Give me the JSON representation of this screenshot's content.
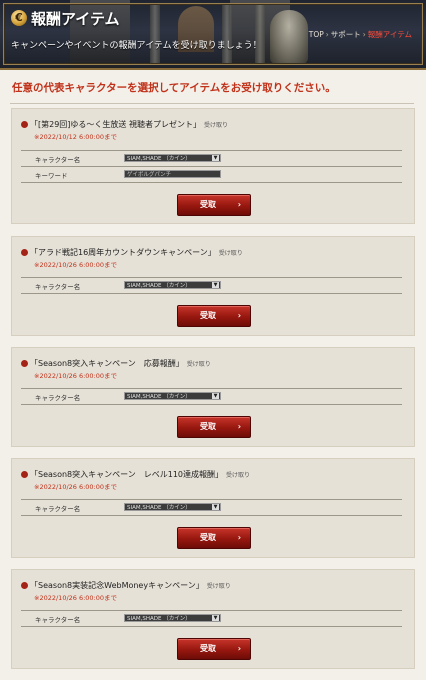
{
  "header": {
    "title": "報酬アイテム",
    "subtitle": "キャンペーンやイベントの報酬アイテムを受け取りましょう！",
    "breadcrumb": [
      "TOP",
      "サポート",
      "報酬アイテム"
    ]
  },
  "instruction": "任意の代表キャラクターを選択してアイテムをお受け取りください。",
  "campaigns": [
    {
      "title": "「[第29回]ゆる～く生放送 視聴者プレゼント」",
      "suffix": "受け取り",
      "deadline": "※2022/10/12 6:00:00まで",
      "character_label": "キャラクター名",
      "character_value": "SIAM,SHADE （カイン）",
      "keyword_label": "キーワード",
      "keyword_value": "ゲイボルグパンチ",
      "button_label": "受取"
    },
    {
      "title": "「アラド戦記16周年カウントダウンキャンペーン」",
      "suffix": "受け取り",
      "deadline": "※2022/10/26 6:00:00まで",
      "character_label": "キャラクター名",
      "character_value": "SIAM,SHADE （カイン）",
      "button_label": "受取"
    },
    {
      "title": "「Season8突入キャンペーン　応募報酬」",
      "suffix": "受け取り",
      "deadline": "※2022/10/26 6:00:00まで",
      "character_label": "キャラクター名",
      "character_value": "SIAM,SHADE （カイン）",
      "button_label": "受取"
    },
    {
      "title": "「Season8突入キャンペーン　レベル110達成報酬」",
      "suffix": "受け取り",
      "deadline": "※2022/10/26 6:00:00まで",
      "character_label": "キャラクター名",
      "character_value": "SIAM,SHADE （カイン）",
      "button_label": "受取"
    },
    {
      "title": "「Season8実装記念WebMoneyキャンペーン」",
      "suffix": "受け取り",
      "deadline": "※2022/10/26 6:00:00まで",
      "character_label": "キャラクター名",
      "character_value": "SIAM,SHADE （カイン）",
      "button_label": "受取"
    }
  ]
}
